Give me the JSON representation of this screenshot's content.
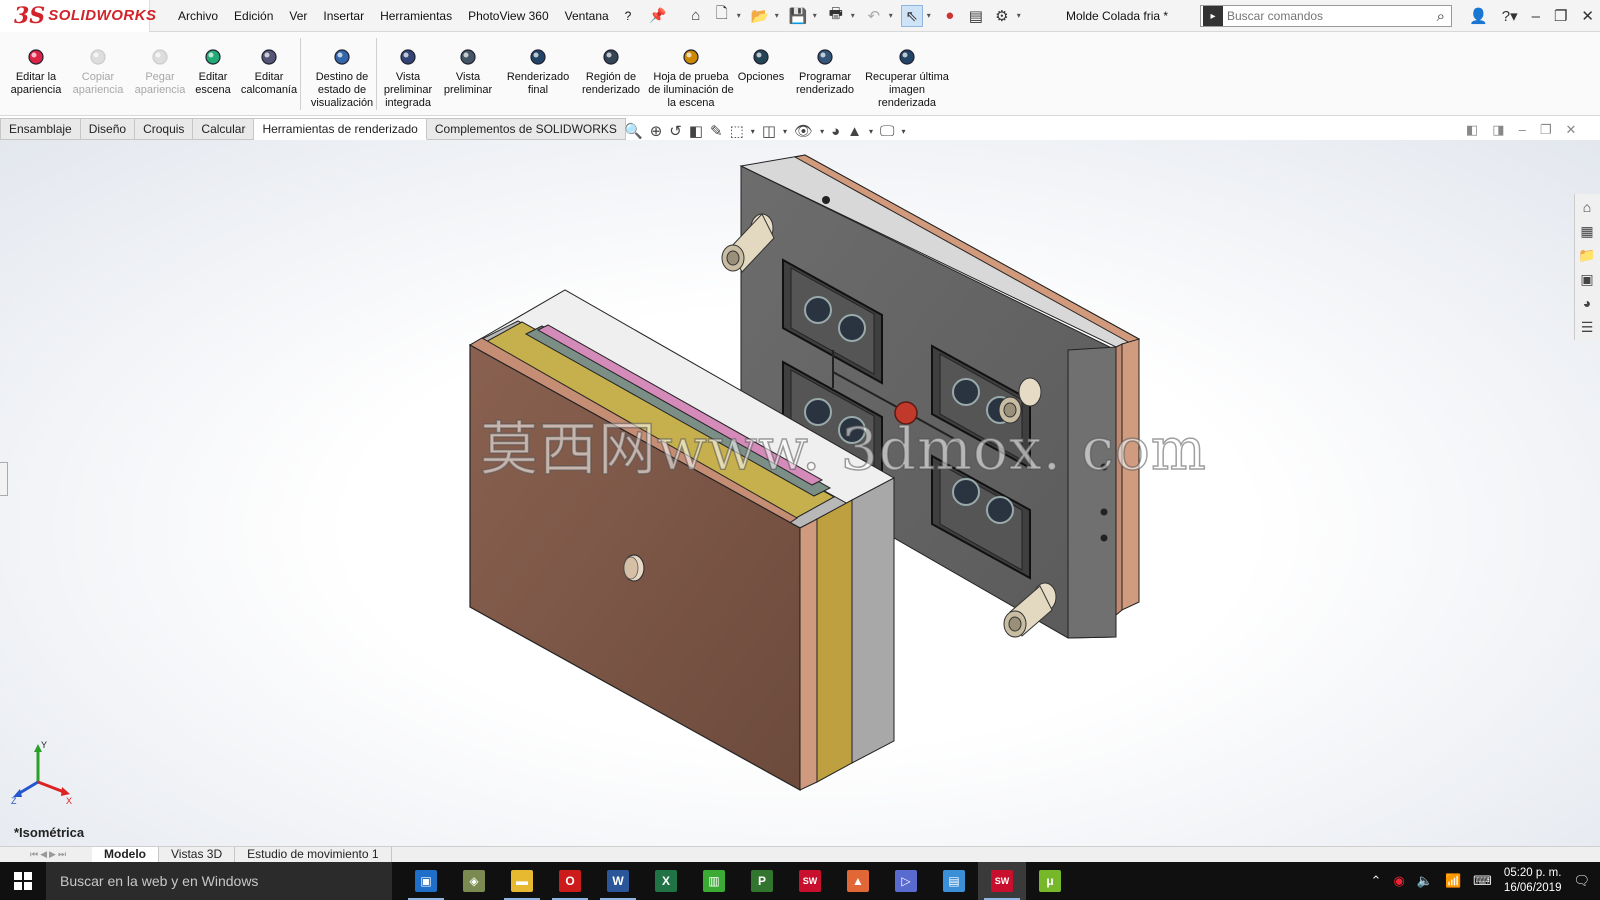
{
  "app": {
    "logo_prefix": "3S",
    "logo_text": "SOLIDWORKS",
    "document_title": "Molde Colada fria *"
  },
  "menu": [
    "Archivo",
    "Edición",
    "Ver",
    "Insertar",
    "Herramientas",
    "PhotoView 360",
    "Ventana",
    "?"
  ],
  "search": {
    "placeholder": "Buscar comandos"
  },
  "ribbon": {
    "buttons": [
      {
        "label": "Editar la apariencia",
        "disabled": false,
        "icon": "appearance-icon"
      },
      {
        "label": "Copiar apariencia",
        "disabled": true,
        "icon": "copy-appearance-icon"
      },
      {
        "label": "Pegar apariencia",
        "disabled": true,
        "icon": "paste-appearance-icon"
      },
      {
        "label": "Editar escena",
        "disabled": false,
        "icon": "scene-icon"
      },
      {
        "label": "Editar calcomanía",
        "disabled": false,
        "icon": "decal-icon"
      },
      {
        "label": "Destino de estado de visualización",
        "disabled": false,
        "icon": "target-icon"
      },
      {
        "label": "Vista preliminar integrada",
        "disabled": false,
        "icon": "integrated-preview-icon"
      },
      {
        "label": "Vista preliminar",
        "disabled": false,
        "icon": "preview-icon"
      },
      {
        "label": "Renderizado final",
        "disabled": false,
        "icon": "final-render-icon"
      },
      {
        "label": "Región de renderizado",
        "disabled": false,
        "icon": "render-region-icon"
      },
      {
        "label": "Hoja de prueba de iluminación de la escena",
        "disabled": false,
        "icon": "lighting-proof-icon"
      },
      {
        "label": "Opciones",
        "disabled": false,
        "icon": "options-icon"
      },
      {
        "label": "Programar renderizado",
        "disabled": false,
        "icon": "schedule-render-icon"
      },
      {
        "label": "Recuperar última imagen renderizada",
        "disabled": false,
        "icon": "recover-render-icon"
      }
    ]
  },
  "command_tabs": [
    {
      "label": "Ensamblaje",
      "active": false
    },
    {
      "label": "Diseño",
      "active": false
    },
    {
      "label": "Croquis",
      "active": false
    },
    {
      "label": "Calcular",
      "active": false
    },
    {
      "label": "Herramientas de renderizado",
      "active": true
    },
    {
      "label": "Complementos de SOLIDWORKS",
      "active": false
    }
  ],
  "viewport": {
    "watermark": "莫西网www. 3dmox. com",
    "view_name": "*Isométrica",
    "triad": {
      "x": "X",
      "y": "Y",
      "z": "Z"
    }
  },
  "bottom_tabs": [
    {
      "label": "Modelo",
      "active": true
    },
    {
      "label": "Vistas 3D",
      "active": false
    },
    {
      "label": "Estudio de movimiento 1",
      "active": false
    }
  ],
  "taskbar": {
    "search_placeholder": "Buscar en la web y en Windows",
    "apps": [
      {
        "name": "photos-app",
        "color": "#1f6fc9",
        "glyph": "▣",
        "running": true,
        "active": false
      },
      {
        "name": "3d-app",
        "color": "#7a8a50",
        "glyph": "◈",
        "running": false,
        "active": false
      },
      {
        "name": "file-explorer",
        "color": "#e7b930",
        "glyph": "▬",
        "running": true,
        "active": false
      },
      {
        "name": "opera-browser",
        "color": "#cc1b1b",
        "glyph": "O",
        "running": true,
        "active": false
      },
      {
        "name": "word-app",
        "color": "#2b579a",
        "glyph": "W",
        "running": true,
        "active": false
      },
      {
        "name": "excel-app",
        "color": "#217346",
        "glyph": "X",
        "running": false,
        "active": false
      },
      {
        "name": "charts-app",
        "color": "#3aaa35",
        "glyph": "▥",
        "running": false,
        "active": false
      },
      {
        "name": "project-app",
        "color": "#31752f",
        "glyph": "P",
        "running": false,
        "active": false
      },
      {
        "name": "solidworks-2018-a",
        "color": "#c8102e",
        "glyph": "SW",
        "running": false,
        "active": false
      },
      {
        "name": "matlab-app",
        "color": "#e16737",
        "glyph": "▲",
        "running": false,
        "active": false
      },
      {
        "name": "media-app",
        "color": "#5a6bd0",
        "glyph": "▷",
        "running": false,
        "active": false
      },
      {
        "name": "remote-desktop-app",
        "color": "#3b8fd6",
        "glyph": "▤",
        "running": false,
        "active": false
      },
      {
        "name": "solidworks-2018-b",
        "color": "#c8102e",
        "glyph": "SW",
        "running": true,
        "active": true
      },
      {
        "name": "utorrent-app",
        "color": "#76b82a",
        "glyph": "μ",
        "running": false,
        "active": false
      }
    ],
    "clock_time": "05:20 p. m.",
    "clock_date": "16/06/2019"
  }
}
